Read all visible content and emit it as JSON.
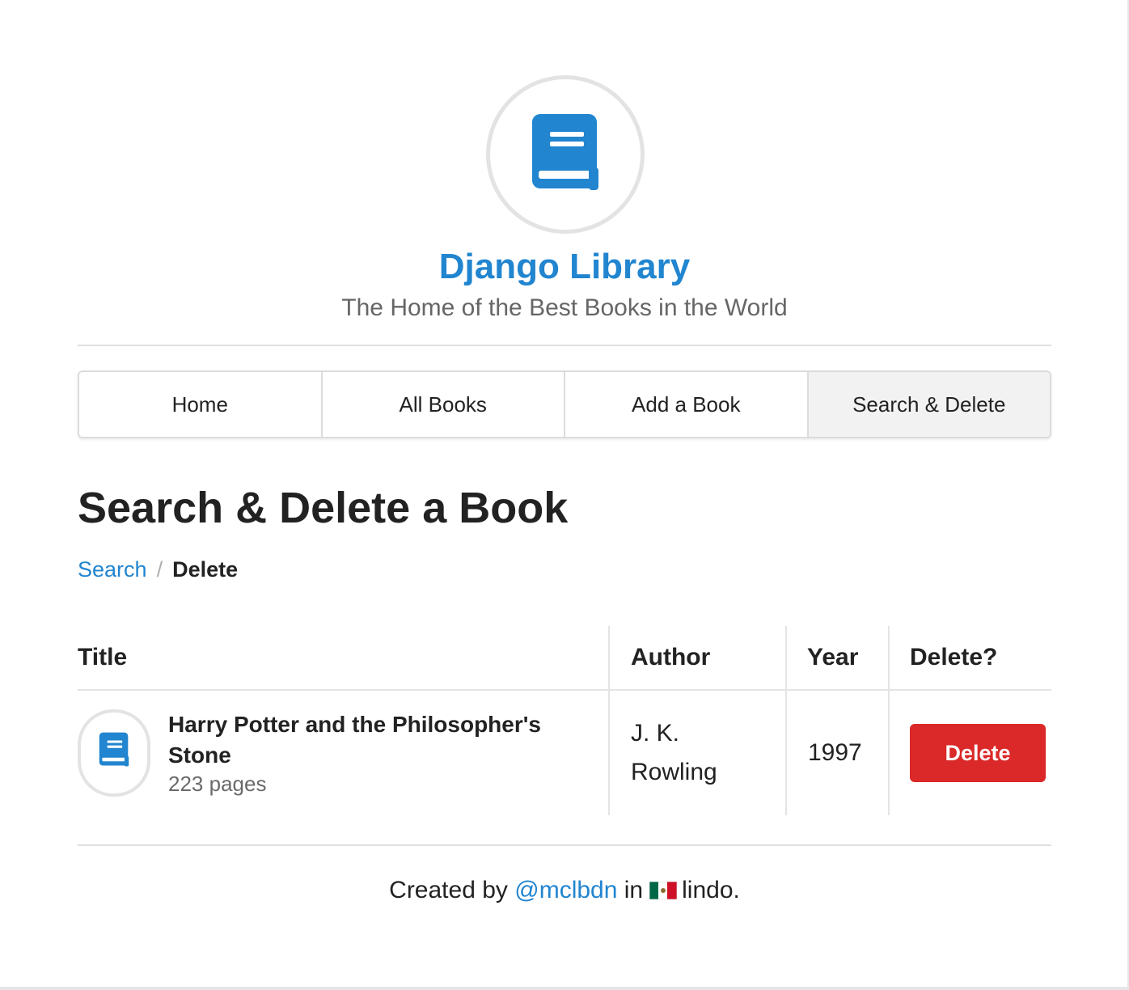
{
  "header": {
    "logo_icon": "book-icon",
    "title": "Django Library",
    "subtitle": "The Home of the Best Books in the World",
    "accent_color": "#2185d0"
  },
  "menu": {
    "items": [
      {
        "label": "Home",
        "active": false
      },
      {
        "label": "All Books",
        "active": false
      },
      {
        "label": "Add a Book",
        "active": false
      },
      {
        "label": "Search & Delete",
        "active": true
      }
    ]
  },
  "main": {
    "heading": "Search & Delete a Book",
    "breadcrumb": {
      "link": "Search",
      "separator": "/",
      "current": "Delete"
    },
    "table": {
      "columns": [
        "Title",
        "Author",
        "Year",
        "Delete?"
      ],
      "rows": [
        {
          "icon": "book-icon",
          "title": "Harry Potter and the Philosopher's Stone",
          "pages": "223 pages",
          "author": "J. K. Rowling",
          "year": "1997",
          "delete_label": "Delete"
        }
      ]
    },
    "delete_color": "#db2828"
  },
  "footer": {
    "prefix": "Created by",
    "link": "@mclbdn",
    "middle": "in",
    "flag_icon": "mexico-flag-icon",
    "suffix": "lindo."
  }
}
